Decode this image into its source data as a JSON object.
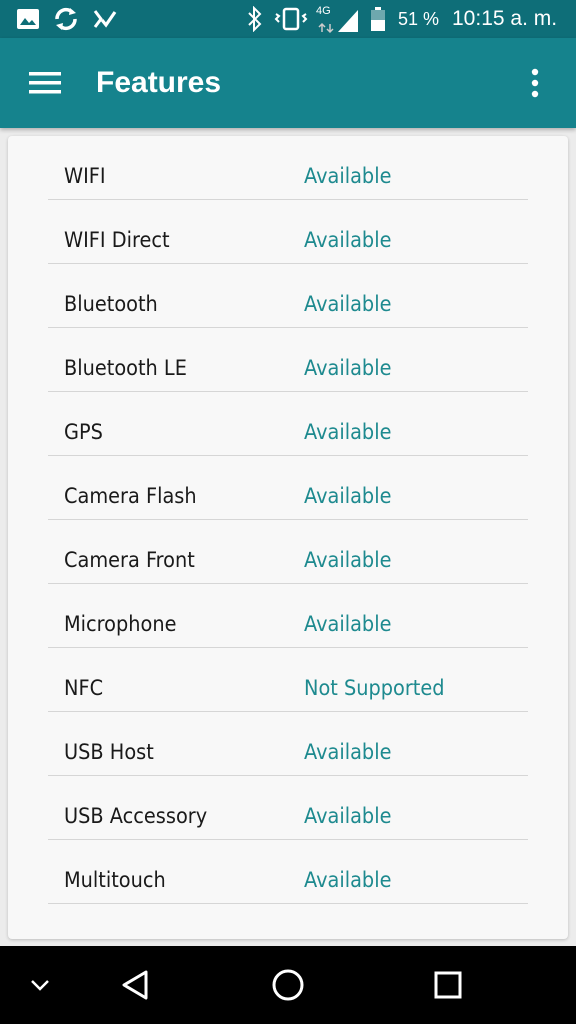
{
  "status_bar": {
    "icons": [
      "image-icon",
      "sync-icon",
      "checklist-icon",
      "bluetooth-icon",
      "vibrate-icon",
      "signal-4g-icon",
      "battery-icon"
    ],
    "network": "4G",
    "battery": "51 %",
    "time": "10:15 a. m."
  },
  "app_bar": {
    "title": "Features",
    "menu_icon": "hamburger-menu-icon",
    "overflow_icon": "more-vert-icon",
    "color": "#15838d"
  },
  "features": [
    {
      "name": "WIFI",
      "status": "Available"
    },
    {
      "name": "WIFI Direct",
      "status": "Available"
    },
    {
      "name": "Bluetooth",
      "status": "Available"
    },
    {
      "name": "Bluetooth LE",
      "status": "Available"
    },
    {
      "name": "GPS",
      "status": "Available"
    },
    {
      "name": "Camera Flash",
      "status": "Available"
    },
    {
      "name": "Camera Front",
      "status": "Available"
    },
    {
      "name": "Microphone",
      "status": "Available"
    },
    {
      "name": "NFC",
      "status": "Not Supported"
    },
    {
      "name": "USB Host",
      "status": "Available"
    },
    {
      "name": "USB Accessory",
      "status": "Available"
    },
    {
      "name": "Multitouch",
      "status": "Available"
    }
  ],
  "nav_bar": {
    "icons": [
      "collapse-chevron-icon",
      "back-icon",
      "home-icon",
      "recents-icon"
    ]
  },
  "colors": {
    "status_bar": "#0e6e78",
    "accent_text": "#1e8a8f"
  }
}
